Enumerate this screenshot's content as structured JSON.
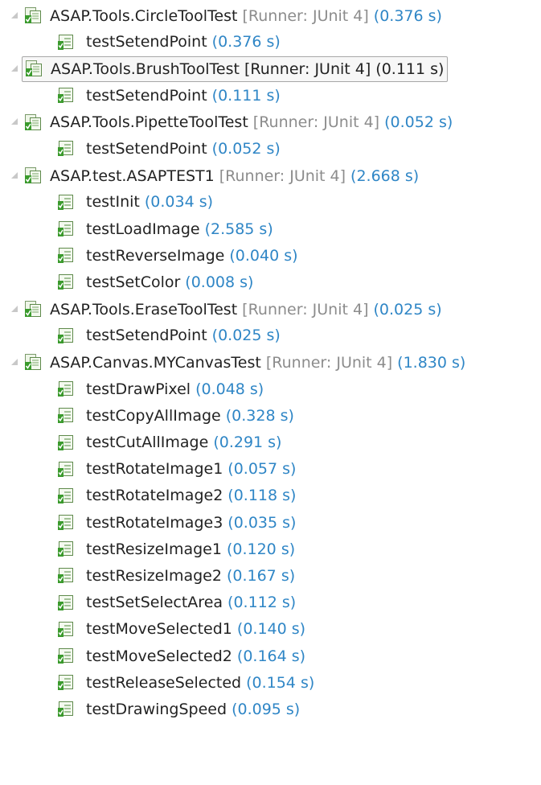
{
  "icons": {
    "suite": "test-suite-passed-icon",
    "case": "test-case-passed-icon"
  },
  "colors": {
    "time": "#2f86c6",
    "runner": "#8c8c8c",
    "icon_green": "#3a9a2c",
    "twisty": "#c8c8c8"
  },
  "suites": [
    {
      "name": "ASAP.Tools.CircleToolTest",
      "runner": "[Runner: JUnit 4]",
      "time": "(0.376 s)",
      "selected": false,
      "tests": [
        {
          "name": "testSetendPoint",
          "time": "(0.376 s)"
        }
      ]
    },
    {
      "name": "ASAP.Tools.BrushToolTest",
      "runner": "[Runner: JUnit 4]",
      "time": "(0.111 s)",
      "selected": true,
      "tests": [
        {
          "name": "testSetendPoint",
          "time": "(0.111 s)"
        }
      ]
    },
    {
      "name": "ASAP.Tools.PipetteToolTest",
      "runner": "[Runner: JUnit 4]",
      "time": "(0.052 s)",
      "selected": false,
      "tests": [
        {
          "name": "testSetendPoint",
          "time": "(0.052 s)"
        }
      ]
    },
    {
      "name": "ASAP.test.ASAPTEST1",
      "runner": "[Runner: JUnit 4]",
      "time": "(2.668 s)",
      "selected": false,
      "tests": [
        {
          "name": "testInit",
          "time": "(0.034 s)"
        },
        {
          "name": "testLoadImage",
          "time": "(2.585 s)"
        },
        {
          "name": "testReverseImage",
          "time": "(0.040 s)"
        },
        {
          "name": "testSetColor",
          "time": "(0.008 s)"
        }
      ]
    },
    {
      "name": "ASAP.Tools.EraseToolTest",
      "runner": "[Runner: JUnit 4]",
      "time": "(0.025 s)",
      "selected": false,
      "tests": [
        {
          "name": "testSetendPoint",
          "time": "(0.025 s)"
        }
      ]
    },
    {
      "name": "ASAP.Canvas.MYCanvasTest",
      "runner": "[Runner: JUnit 4]",
      "time": "(1.830 s)",
      "selected": false,
      "tests": [
        {
          "name": "testDrawPixel",
          "time": "(0.048 s)"
        },
        {
          "name": "testCopyAllImage",
          "time": "(0.328 s)"
        },
        {
          "name": "testCutAllImage",
          "time": "(0.291 s)"
        },
        {
          "name": "testRotateImage1",
          "time": "(0.057 s)"
        },
        {
          "name": "testRotateImage2",
          "time": "(0.118 s)"
        },
        {
          "name": "testRotateImage3",
          "time": "(0.035 s)"
        },
        {
          "name": "testResizeImage1",
          "time": "(0.120 s)"
        },
        {
          "name": "testResizeImage2",
          "time": "(0.167 s)"
        },
        {
          "name": "testSetSelectArea",
          "time": "(0.112 s)"
        },
        {
          "name": "testMoveSelected1",
          "time": "(0.140 s)"
        },
        {
          "name": "testMoveSelected2",
          "time": "(0.164 s)"
        },
        {
          "name": "testReleaseSelected",
          "time": "(0.154 s)"
        },
        {
          "name": "testDrawingSpeed",
          "time": "(0.095 s)"
        }
      ]
    }
  ]
}
